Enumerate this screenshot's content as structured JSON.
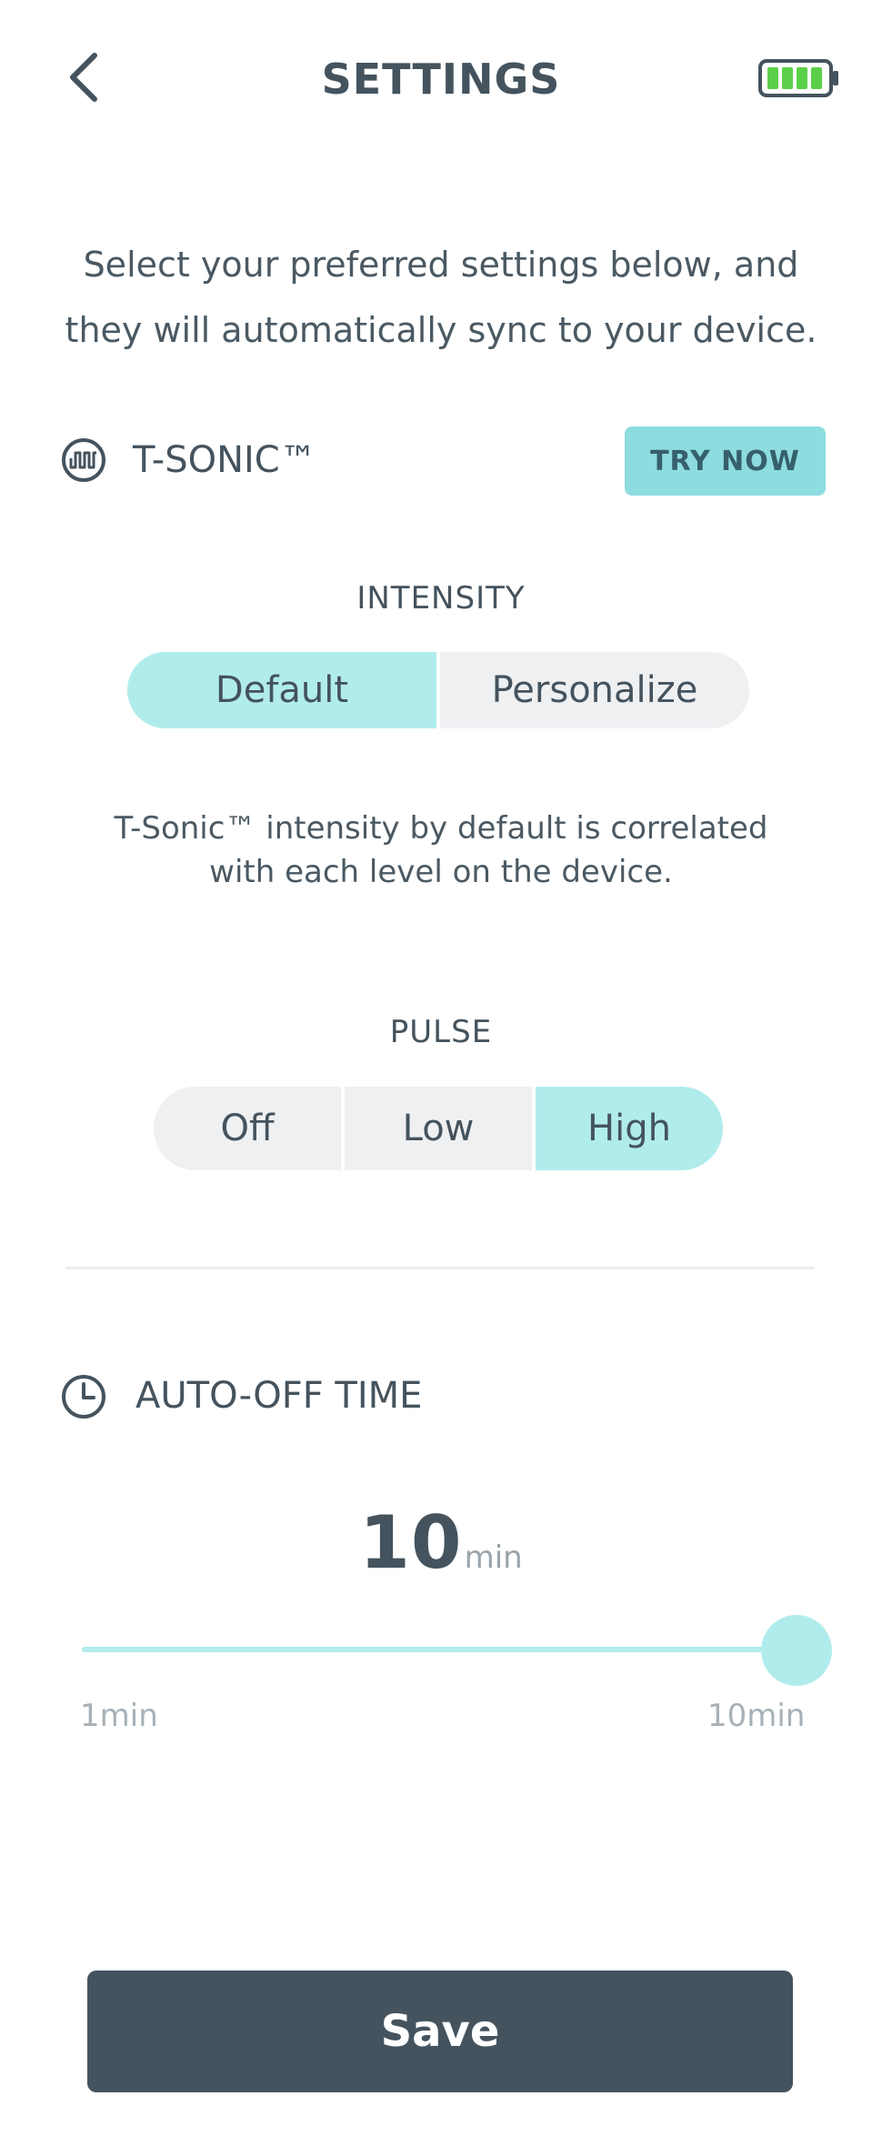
{
  "header": {
    "title": "SETTINGS",
    "back_icon": "chevron-left-icon",
    "battery_icon": "battery-full-icon",
    "battery_level": 1.0
  },
  "intro": {
    "line1": "Select your preferred settings below, and",
    "line2": "they will automatically sync to your device."
  },
  "tsonic": {
    "icon": "wave-icon",
    "title": "T-SONIC™",
    "try_now": "TRY NOW",
    "intensity_label": "INTENSITY",
    "intensity_options": [
      "Default",
      "Personalize"
    ],
    "intensity_selected": "Default",
    "intensity_note_line1": "T-Sonic™ intensity by default is correlated",
    "intensity_note_line2": "with each level on the device.",
    "pulse_label": "PULSE",
    "pulse_options": [
      "Off",
      "Low",
      "High"
    ],
    "pulse_selected": "High"
  },
  "auto_off": {
    "icon": "clock-icon",
    "title": "AUTO-OFF TIME",
    "value": "10",
    "unit": "min",
    "slider_min_label": "1min",
    "slider_max_label": "10min",
    "slider_min": 1,
    "slider_max": 10,
    "slider_value": 10
  },
  "actions": {
    "save": "Save"
  },
  "colors": {
    "accent": "#b1ecec",
    "button_teal": "#8ddcdf",
    "primary_dark": "#44535e",
    "battery_green": "#5ccf4a"
  }
}
